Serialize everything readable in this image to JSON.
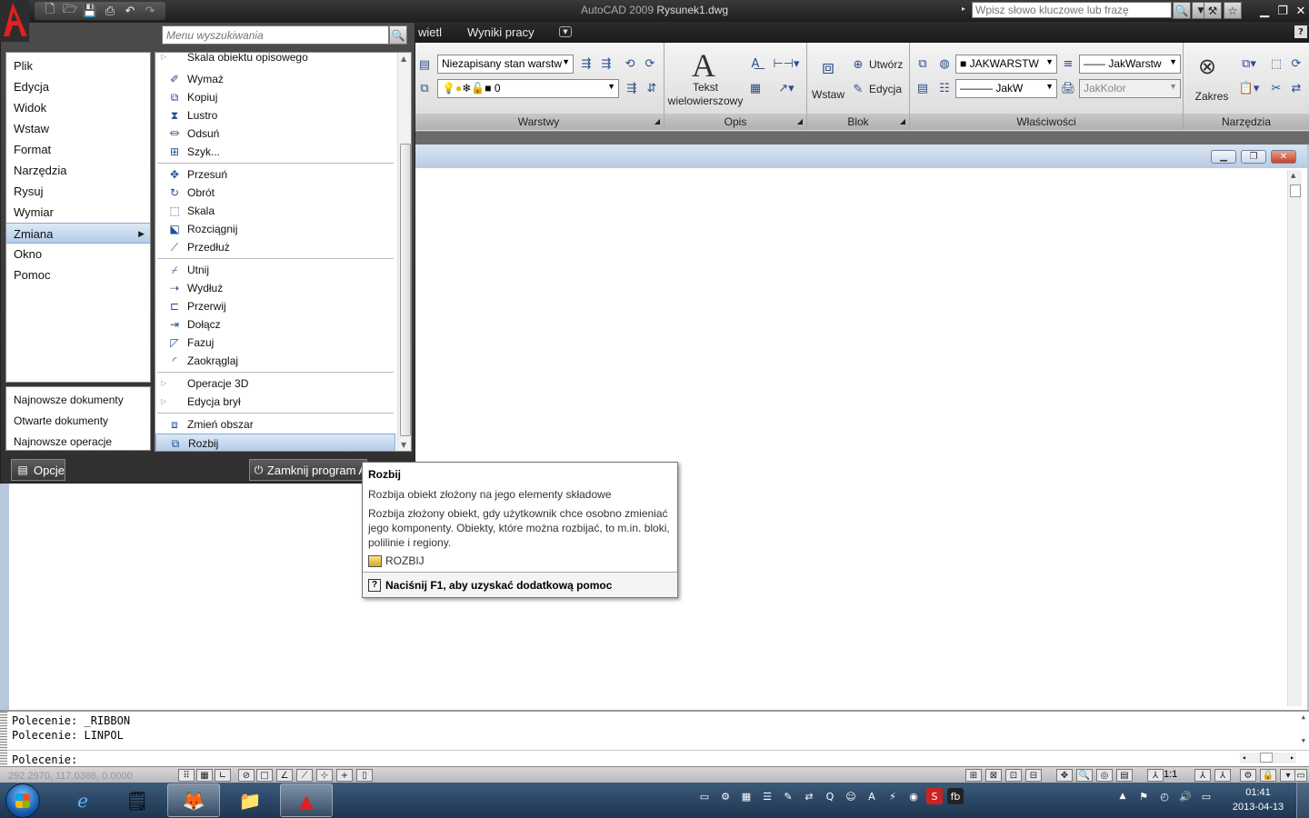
{
  "window": {
    "title_app": "AutoCAD 2009",
    "title_doc": "Rysunek1.dwg",
    "search_placeholder": "Wpisz słowo kluczowe lub frazę"
  },
  "ribbon": {
    "tabs": [
      "wietl",
      "Wyniki pracy"
    ],
    "panels": {
      "warstwy": {
        "title": "Warstwy",
        "layer_state": "Niezapisany stan warstw",
        "current_layer": "0"
      },
      "opis": {
        "title": "Opis",
        "text_label_1": "Tekst",
        "text_label_2": "wielowierszowy"
      },
      "blok": {
        "title": "Blok",
        "insert_label": "Wstaw",
        "create_label": "Utwórz",
        "edit_label": "Edycja"
      },
      "wlasciwosci": {
        "title": "Właściwości",
        "color": "JAKWARSTW",
        "linetype": "JakWarstw",
        "lineweight": "JakW",
        "plotstyle": "JakKolor"
      },
      "narzedzia": {
        "title": "Narzędzia",
        "zoom_label": "Zakres"
      }
    }
  },
  "app_menu": {
    "search_placeholder": "Menu wyszukiwania",
    "left_items": [
      "Plik",
      "Edycja",
      "Widok",
      "Wstaw",
      "Format",
      "Narzędzia",
      "Rysuj",
      "Wymiar",
      "Zmiana",
      "Okno",
      "Pomoc"
    ],
    "left_selected_index": 8,
    "bottom_items": [
      "Najnowsze dokumenty",
      "Otwarte dokumenty",
      "Najnowsze operacje"
    ],
    "right_items": [
      {
        "label": "Skala obiektu opisowego",
        "icon": "submenu-icon"
      },
      {
        "label": "Wymaż",
        "icon": "eraser-icon"
      },
      {
        "label": "Kopiuj",
        "icon": "copy-icon"
      },
      {
        "label": "Lustro",
        "icon": "mirror-icon"
      },
      {
        "label": "Odsuń",
        "icon": "offset-icon"
      },
      {
        "label": "Szyk...",
        "icon": "array-icon"
      },
      {
        "label": "Przesuń",
        "icon": "move-icon"
      },
      {
        "label": "Obrót",
        "icon": "rotate-icon"
      },
      {
        "label": "Skala",
        "icon": "scale-icon"
      },
      {
        "label": "Rozciągnij",
        "icon": "stretch-icon"
      },
      {
        "label": "Przedłuż",
        "icon": "lengthen-icon"
      },
      {
        "label": "Utnij",
        "icon": "trim-icon"
      },
      {
        "label": "Wydłuż",
        "icon": "extend-icon"
      },
      {
        "label": "Przerwij",
        "icon": "break-icon"
      },
      {
        "label": "Dołącz",
        "icon": "join-icon"
      },
      {
        "label": "Fazuj",
        "icon": "chamfer-icon"
      },
      {
        "label": "Zaokrąglaj",
        "icon": "fillet-icon"
      },
      {
        "label": "Operacje 3D",
        "icon": "submenu-icon"
      },
      {
        "label": "Edycja brył",
        "icon": "submenu-icon"
      },
      {
        "label": "Zmień obszar",
        "icon": "change-space-icon"
      },
      {
        "label": "Rozbij",
        "icon": "explode-icon"
      }
    ],
    "options_label": "Opcje",
    "exit_label": "Zamknij program A"
  },
  "tooltip": {
    "title": "Rozbij",
    "short": "Rozbija obiekt złożony na jego elementy składowe",
    "long": "Rozbija złożony obiekt, gdy użytkownik chce osobno zmieniać jego komponenty. Obiekty, które można rozbijać, to m.in. bloki, polilinie i regiony.",
    "command": "ROZBIJ",
    "help": "Naciśnij F1, aby uzyskać dodatkową pomoc"
  },
  "command_line": {
    "history": [
      "Polecenie:  _RIBBON",
      "Polecenie: LINPOL"
    ],
    "prompt": "Polecenie:"
  },
  "status_bar": {
    "coords": "292.2970, 117.0386, 0.0000",
    "scale": "1:1"
  },
  "taskbar": {
    "time": "01:41",
    "date": "2013-04-13"
  }
}
